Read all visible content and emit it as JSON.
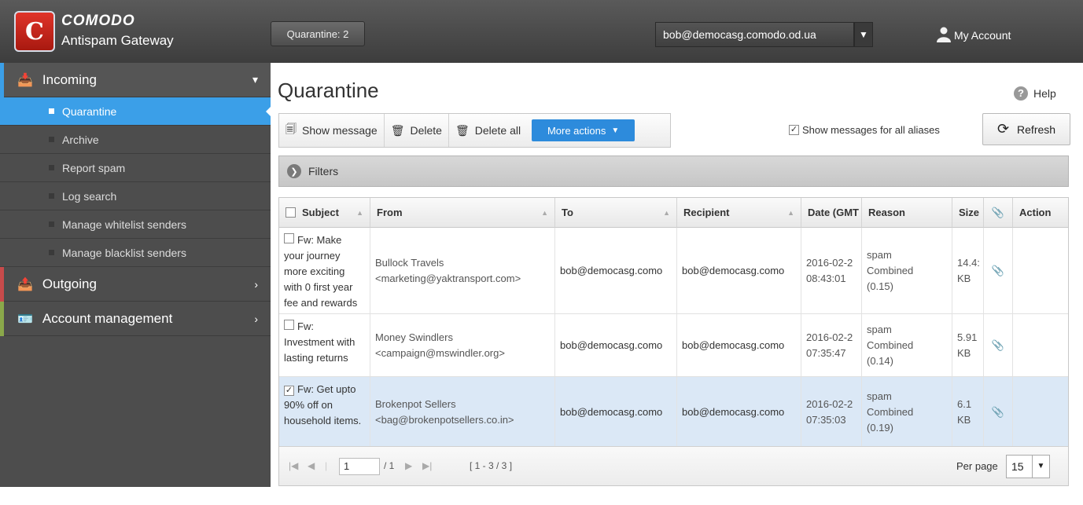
{
  "header": {
    "brand_name": "COMODO",
    "product_name": "Antispam Gateway",
    "quarantine_button": "Quarantine: 2",
    "email_selected": "bob@democasg.comodo.od.ua",
    "my_account": "My Account"
  },
  "sidebar": {
    "incoming": "Incoming",
    "sub_items": [
      "Quarantine",
      "Archive",
      "Report spam",
      "Log search",
      "Manage whitelist senders",
      "Manage blacklist senders"
    ],
    "outgoing": "Outgoing",
    "account_management": "Account management"
  },
  "page": {
    "title": "Quarantine",
    "help": "Help"
  },
  "toolbar": {
    "show_message": "Show message",
    "delete": "Delete",
    "delete_all": "Delete all",
    "more_actions": "More actions",
    "show_aliases": "Show messages for all aliases",
    "refresh": "Refresh"
  },
  "filters": {
    "label": "Filters"
  },
  "table": {
    "columns": [
      "Subject",
      "From",
      "To",
      "Recipient",
      "Date (GMT",
      "Reason",
      "Size",
      "Action"
    ],
    "rows": [
      {
        "checked": false,
        "subject_line1": "Fw: Make",
        "subject_rest": "your journey more exciting with 0 first year fee and rewards",
        "from_name": "Bullock Travels",
        "from_email": "<marketing@yaktransport.com>",
        "to": "bob@democasg.como",
        "recipient": "bob@democasg.como",
        "date": "2016-02-2",
        "time": "08:43:01",
        "reason_1": "spam",
        "reason_2": "Combined",
        "reason_3": "(0.15)",
        "size": "14.4:",
        "size_unit": "KB"
      },
      {
        "checked": false,
        "subject_line1": "Fw:",
        "subject_rest": "Investment with lasting returns",
        "from_name": "Money Swindlers",
        "from_email": "<campaign@mswindler.org>",
        "to": "bob@democasg.como",
        "recipient": "bob@democasg.como",
        "date": "2016-02-2",
        "time": "07:35:47",
        "reason_1": "spam",
        "reason_2": "Combined",
        "reason_3": "(0.14)",
        "size": "5.91",
        "size_unit": "KB"
      },
      {
        "checked": true,
        "subject_line1": "Fw: Get upto",
        "subject_rest": "90% off on household items.",
        "from_name": "Brokenpot Sellers",
        "from_email": "<bag@brokenpotsellers.co.in>",
        "to": "bob@democasg.como",
        "recipient": "bob@democasg.como",
        "date": "2016-02-2",
        "time": "07:35:03",
        "reason_1": "spam",
        "reason_2": "Combined",
        "reason_3": "(0.19)",
        "size": "6.1",
        "size_unit": "KB"
      }
    ]
  },
  "pager": {
    "page_value": "1",
    "page_total": "/ 1",
    "range": "[ 1 - 3 / 3 ]",
    "per_page_label": "Per page",
    "per_page_value": "15"
  },
  "colors": {
    "active_nav": "#3b9fe8",
    "more_actions": "#2d8bdc",
    "selected_row": "#dbe8f6"
  }
}
